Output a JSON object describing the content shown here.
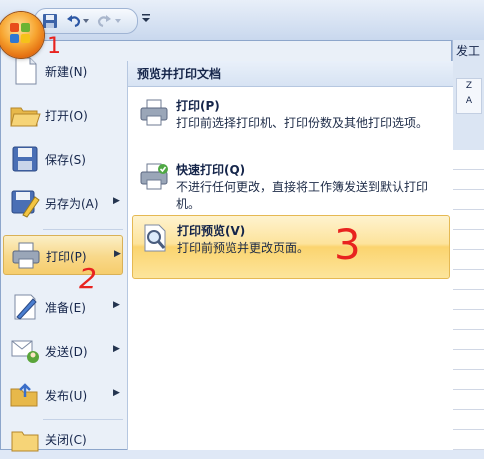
{
  "app": {
    "partial_tab_label": "发工"
  },
  "quick_access": {
    "icons": [
      "save-icon",
      "undo-icon",
      "redo-icon",
      "customize-icon"
    ]
  },
  "office_button": {
    "icon": "office-logo-icon"
  },
  "menu_items": [
    {
      "label": "新建(N)",
      "icon": "new-document-icon",
      "has_arrow": false
    },
    {
      "label": "打开(O)",
      "icon": "folder-open-icon",
      "has_arrow": false
    },
    {
      "label": "保存(S)",
      "icon": "save-icon",
      "has_arrow": false
    },
    {
      "label": "另存为(A)",
      "icon": "save-as-icon",
      "has_arrow": true
    },
    {
      "label": "打印(P)",
      "icon": "printer-icon",
      "has_arrow": true,
      "active": true
    },
    {
      "label": "准备(E)",
      "icon": "prepare-icon",
      "has_arrow": true
    },
    {
      "label": "发送(D)",
      "icon": "send-icon",
      "has_arrow": true
    },
    {
      "label": "发布(U)",
      "icon": "publish-icon",
      "has_arrow": true
    },
    {
      "label": "关闭(C)",
      "icon": "close-folder-icon",
      "has_arrow": false
    }
  ],
  "submenu": {
    "title": "预览并打印文档",
    "items": [
      {
        "title": "打印(P)",
        "description": "打印前选择打印机、打印份数及其他打印选项。",
        "icon": "printer-icon"
      },
      {
        "title": "快速打印(Q)",
        "description": "不进行任何更改，直接将工作簿发送到默认打印机。",
        "icon": "quick-print-icon"
      },
      {
        "title": "打印预览(V)",
        "description": "打印前预览并更改页面。",
        "icon": "print-preview-icon",
        "active": true
      }
    ]
  },
  "annotations": {
    "step1": "1",
    "step2": "2",
    "step3": "3",
    "color": "#e8231f"
  }
}
